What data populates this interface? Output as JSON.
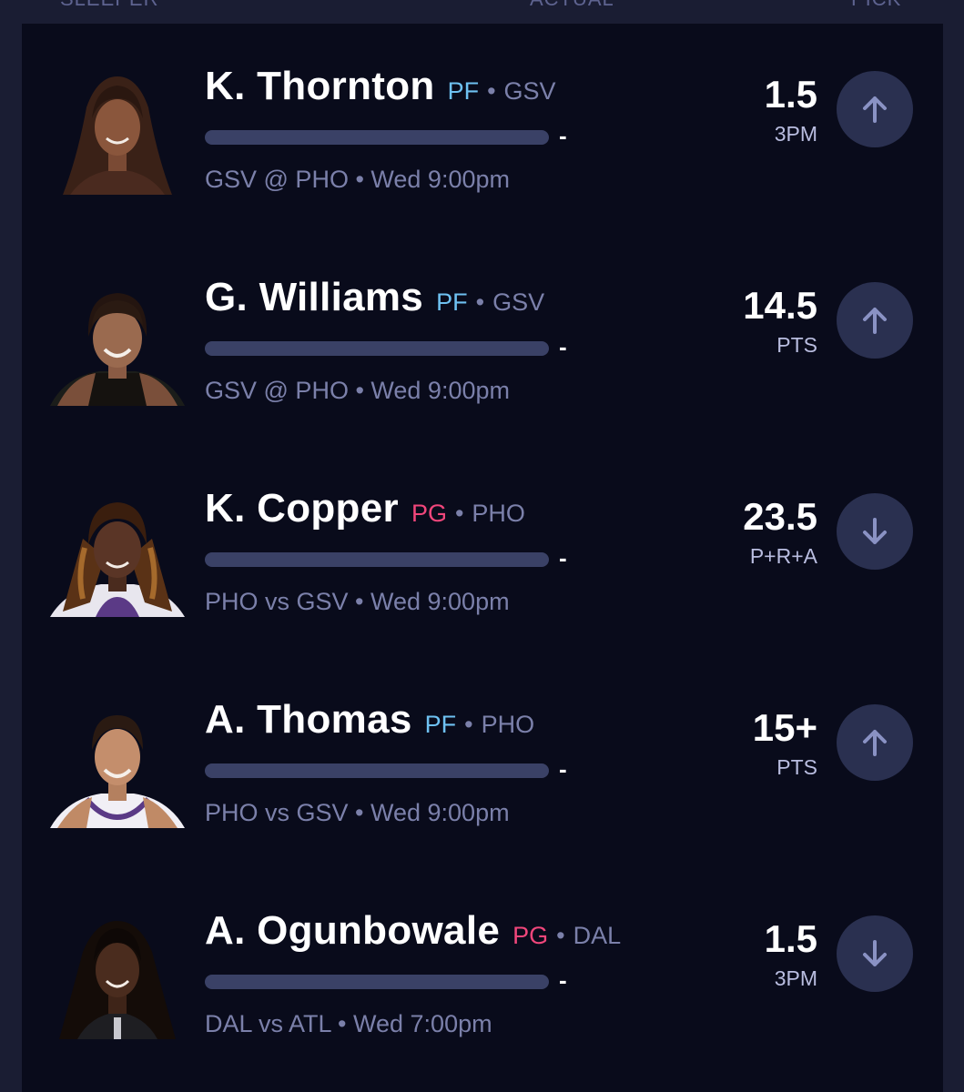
{
  "header": {
    "sleeper": "SLEEPER",
    "actual": "ACTUAL",
    "pick": "PICK"
  },
  "picks": [
    {
      "name": "K. Thornton",
      "position": "PF",
      "team": "GSV",
      "separator": "•",
      "actual": "-",
      "progress": 0,
      "game": "GSV @ PHO • Wed 9:00pm",
      "line": "1.5",
      "stat": "3PM",
      "direction": "up",
      "direction_icon": "arrow-up-icon"
    },
    {
      "name": "G. Williams",
      "position": "PF",
      "team": "GSV",
      "separator": "•",
      "actual": "-",
      "progress": 0,
      "game": "GSV @ PHO • Wed 9:00pm",
      "line": "14.5",
      "stat": "PTS",
      "direction": "up",
      "direction_icon": "arrow-up-icon"
    },
    {
      "name": "K. Copper",
      "position": "PG",
      "team": "PHO",
      "separator": "•",
      "actual": "-",
      "progress": 0,
      "game": "PHO vs GSV • Wed 9:00pm",
      "line": "23.5",
      "stat": "P+R+A",
      "direction": "down",
      "direction_icon": "arrow-down-icon"
    },
    {
      "name": "A. Thomas",
      "position": "PF",
      "team": "PHO",
      "separator": "•",
      "actual": "-",
      "progress": 0,
      "game": "PHO vs GSV • Wed 9:00pm",
      "line": "15+",
      "stat": "PTS",
      "direction": "up",
      "direction_icon": "arrow-up-icon"
    },
    {
      "name": "A. Ogunbowale",
      "position": "PG",
      "team": "DAL",
      "separator": "•",
      "actual": "-",
      "progress": 0,
      "game": "DAL vs ATL • Wed 7:00pm",
      "line": "1.5",
      "stat": "3PM",
      "direction": "down",
      "direction_icon": "arrow-down-icon"
    }
  ],
  "colors": {
    "background": "#1a1d33",
    "panel": "#090b1b",
    "pf": "#6ec1f2",
    "pg": "#f0467b",
    "muted": "#7b80aa",
    "button": "#2a3050",
    "track": "#3a4166"
  }
}
